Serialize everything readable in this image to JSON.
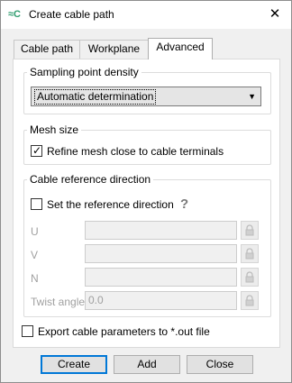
{
  "window": {
    "title": "Create cable path",
    "app_icon_glyph": "≈C"
  },
  "tabs": [
    {
      "label": "Cable path",
      "active": false
    },
    {
      "label": "Workplane",
      "active": false
    },
    {
      "label": "Advanced",
      "active": true
    }
  ],
  "sampling": {
    "legend": "Sampling point density",
    "selected": "Automatic determination"
  },
  "mesh": {
    "legend": "Mesh size",
    "refine_label": "Refine mesh close to cable terminals",
    "refine_checked": true
  },
  "reference": {
    "legend": "Cable reference direction",
    "set_label": "Set the reference direction",
    "set_checked": false,
    "help_glyph": "?",
    "fields": [
      {
        "label": "U",
        "value": ""
      },
      {
        "label": "V",
        "value": ""
      },
      {
        "label": "N",
        "value": ""
      },
      {
        "label": "Twist angle",
        "value": "0.0"
      }
    ]
  },
  "export": {
    "label": "Export cable parameters to *.out file",
    "checked": false
  },
  "buttons": {
    "create": "Create",
    "add": "Add",
    "close": "Close"
  },
  "colors": {
    "accent": "#0078d7",
    "icon_green": "#2e9c6e"
  }
}
